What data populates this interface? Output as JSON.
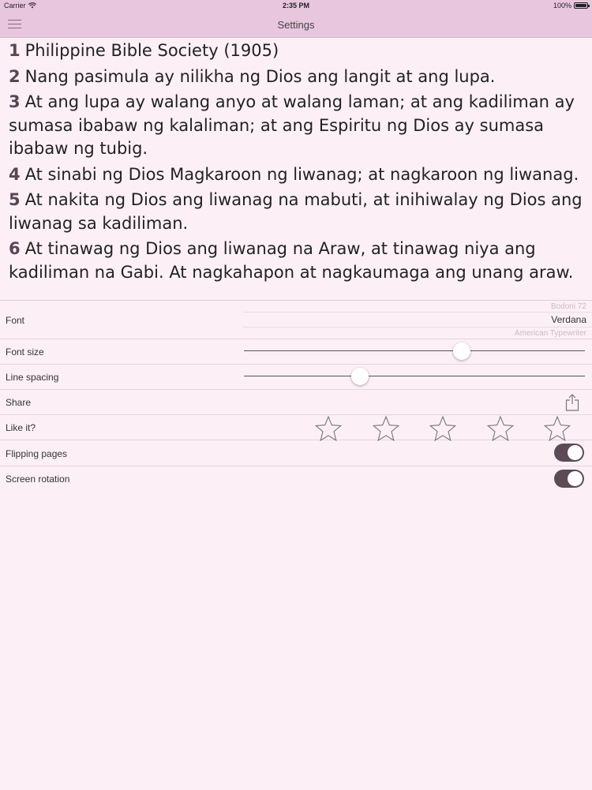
{
  "status_bar": {
    "carrier": "Carrier",
    "time": "2:35 PM",
    "battery": "100%"
  },
  "nav": {
    "title": "Settings"
  },
  "verses": [
    {
      "num": "1",
      "text": "Philippine Bible Society (1905)"
    },
    {
      "num": "2",
      "text": "Nang pasimula ay nilikha ng Dios ang langit at ang lupa."
    },
    {
      "num": "3",
      "text": "At ang lupa ay walang anyo at walang laman; at ang kadiliman ay sumasa ibabaw ng kalaliman; at ang Espiritu ng Dios ay sumasa ibabaw ng tubig."
    },
    {
      "num": "4",
      "text": "At sinabi ng Dios Magkaroon ng liwanag; at nagkaroon ng liwanag."
    },
    {
      "num": "5",
      "text": "At nakita ng Dios ang liwanag na mabuti, at inihiwalay ng Dios ang liwanag sa kadiliman."
    },
    {
      "num": "6",
      "text": "At tinawag ng Dios ang liwanag na Araw, at tinawag niya ang kadiliman na Gabi. At nagkahapon at nagkaumaga ang unang araw."
    }
  ],
  "settings": {
    "font": {
      "label": "Font",
      "option_prev": "Bodoni 72",
      "option_selected": "Verdana",
      "option_next": "American Typewriter"
    },
    "font_size": {
      "label": "Font size",
      "level": 0.64
    },
    "line_spacing": {
      "label": "Line spacing",
      "level": 0.34
    },
    "share": {
      "label": "Share",
      "icon": "share-icon"
    },
    "like": {
      "label": "Like it?",
      "star_count": 5,
      "rating": 0,
      "icon": "star-icon"
    },
    "flipping_pages": {
      "label": "Flipping pages",
      "on": true
    },
    "screen_rotation": {
      "label": "Screen rotation",
      "on": true
    }
  },
  "colors": {
    "bar": "#e8c6de",
    "background": "#fcf0f6",
    "toggle_on": "#5e4a57"
  }
}
